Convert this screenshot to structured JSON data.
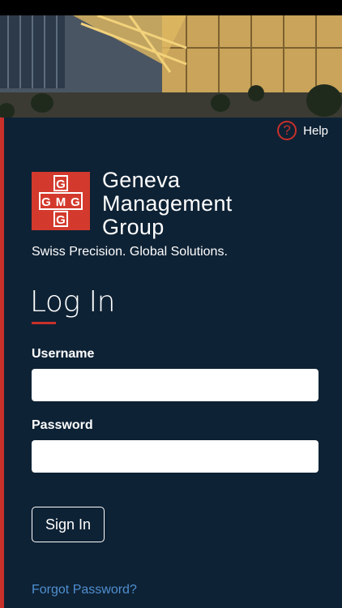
{
  "header": {
    "help_label": "Help",
    "help_icon": "question-circle-icon",
    "hero_image": "building-photo"
  },
  "brand": {
    "logo_letters": "GMG",
    "logo_line1": "Geneva",
    "logo_line2": "Management",
    "logo_line3": "Group",
    "tagline": "Swiss Precision. Global Solutions.",
    "accent_color": "#c8302a",
    "panel_color": "#0e2235"
  },
  "login": {
    "title": "Log In",
    "username_label": "Username",
    "username_value": "",
    "password_label": "Password",
    "password_value": "",
    "sign_in_label": "Sign In",
    "forgot_label": "Forgot Password?"
  }
}
